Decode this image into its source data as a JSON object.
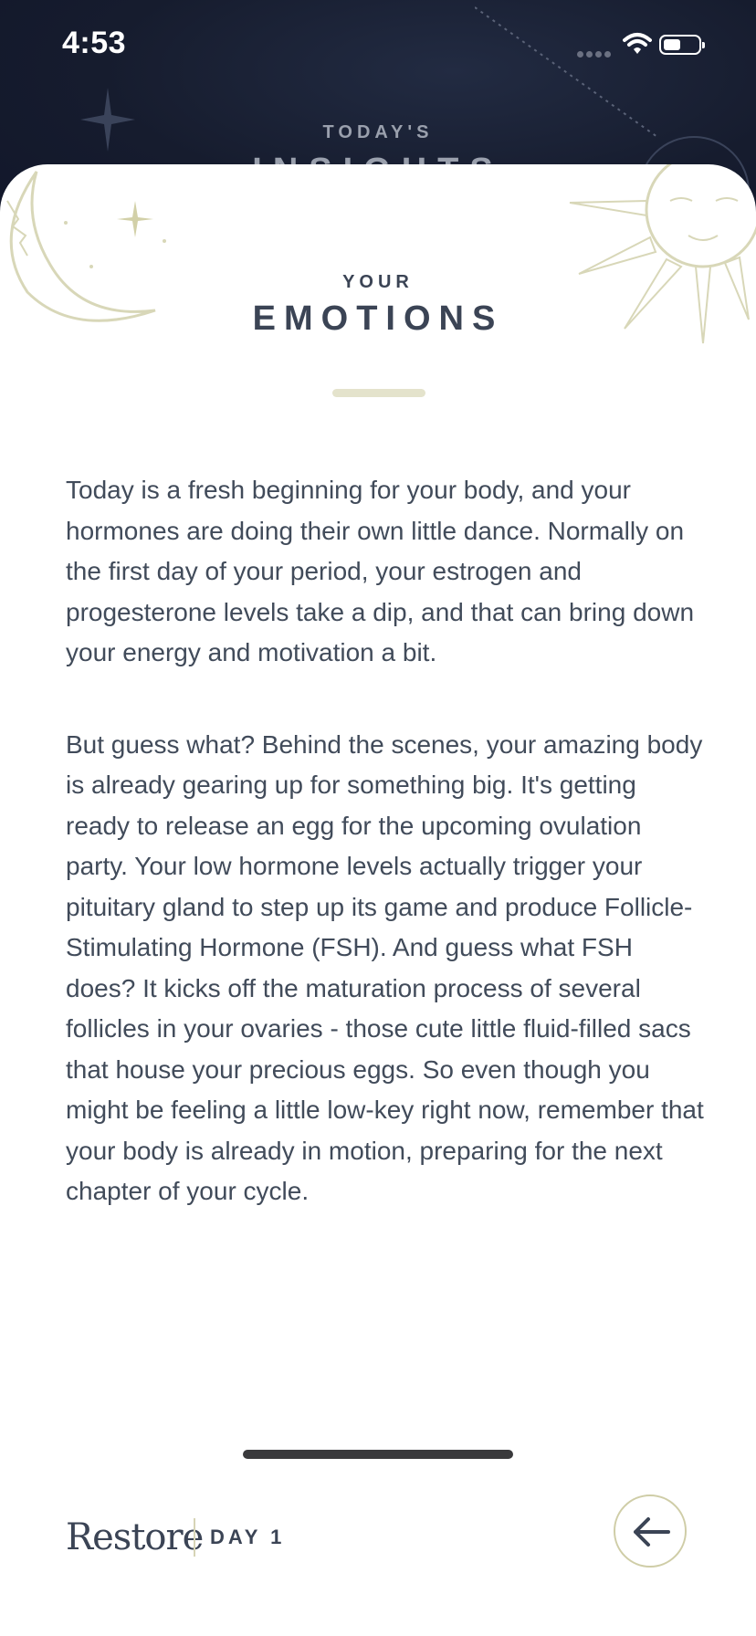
{
  "status_bar": {
    "time": "4:53"
  },
  "background": {
    "kicker": "TODAY'S",
    "title": "INSIGHTS"
  },
  "card": {
    "kicker": "YOUR",
    "title": "EMOTIONS",
    "paragraphs": [
      "Today is a fresh beginning for your body, and your hormones are doing their own little dance. Normally on the first day of your period, your estrogen and progesterone levels take a dip, and that can bring down your energy and motivation a bit.",
      "But guess what? Behind the scenes, your amazing body is already gearing up for something big. It's getting ready to release an egg for the upcoming ovulation party. Your low hormone levels actually trigger your pituitary gland to step up its game and produce Follicle-Stimulating Hormone (FSH). And guess what FSH does? It kicks off the maturation process of several follicles in your ovaries - those cute little fluid-filled sacs that house your precious eggs. So even though you might be feeling a little low-key right now, remember that your body is already in motion, preparing for the next chapter of your cycle."
    ]
  },
  "footer": {
    "brand": "Restore",
    "day": "DAY 1"
  },
  "icons": {
    "moon": "moon-illustration-icon",
    "sun": "sun-illustration-icon",
    "back": "arrow-left-icon",
    "wifi": "wifi-icon",
    "battery": "battery-icon",
    "signal": "cellular-signal-icon"
  },
  "colors": {
    "night_bg": "#141a2b",
    "ink": "#3b4455",
    "gold": "#d6d4b6"
  }
}
